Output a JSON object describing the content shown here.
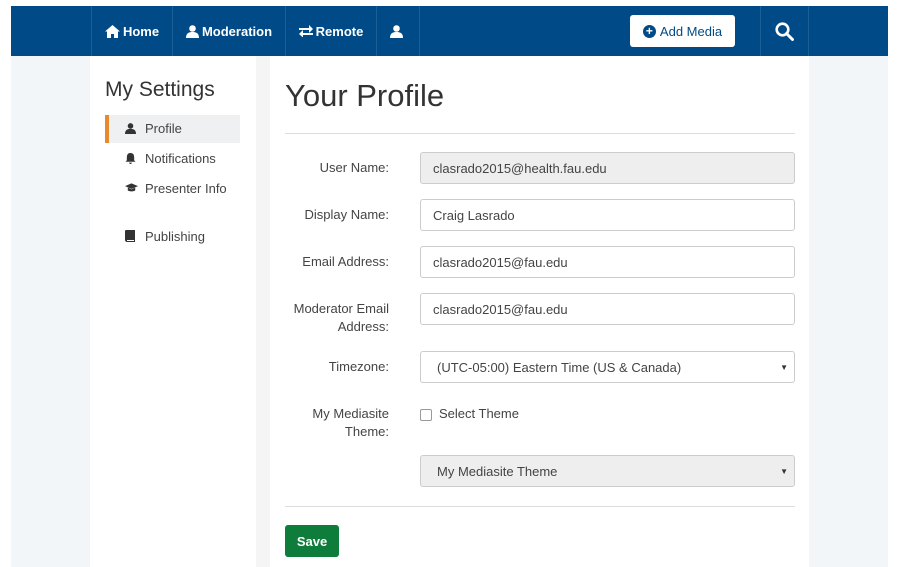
{
  "nav": {
    "home": "Home",
    "moderation": "Moderation",
    "remote": "Remote",
    "add_media": "Add Media"
  },
  "sidebar": {
    "title": "My Settings",
    "items": [
      {
        "label": "Profile",
        "icon": "user-icon",
        "active": true
      },
      {
        "label": "Notifications",
        "icon": "bell-icon",
        "active": false
      },
      {
        "label": "Presenter Info",
        "icon": "graduation-cap-icon",
        "active": false
      },
      {
        "label": "Publishing",
        "icon": "book-icon",
        "active": false
      }
    ]
  },
  "main": {
    "title": "Your Profile",
    "fields": {
      "user_name": {
        "label": "User Name:",
        "value": "clasrado2015@health.fau.edu"
      },
      "display_name": {
        "label": "Display Name:",
        "value": "Craig Lasrado"
      },
      "email": {
        "label": "Email Address:",
        "value": "clasrado2015@fau.edu"
      },
      "moderator_email": {
        "label": "Moderator Email Address:",
        "value": "clasrado2015@fau.edu"
      },
      "timezone": {
        "label": "Timezone:",
        "value": "(UTC-05:00) Eastern Time (US & Canada)"
      },
      "theme": {
        "label": "My Mediasite Theme:",
        "checkbox_label": "Select Theme",
        "value": "My Mediasite Theme"
      }
    },
    "save_label": "Save"
  },
  "colors": {
    "navbar": "#004b87",
    "save": "#0e7d3b",
    "active_accent": "#e8892b"
  }
}
